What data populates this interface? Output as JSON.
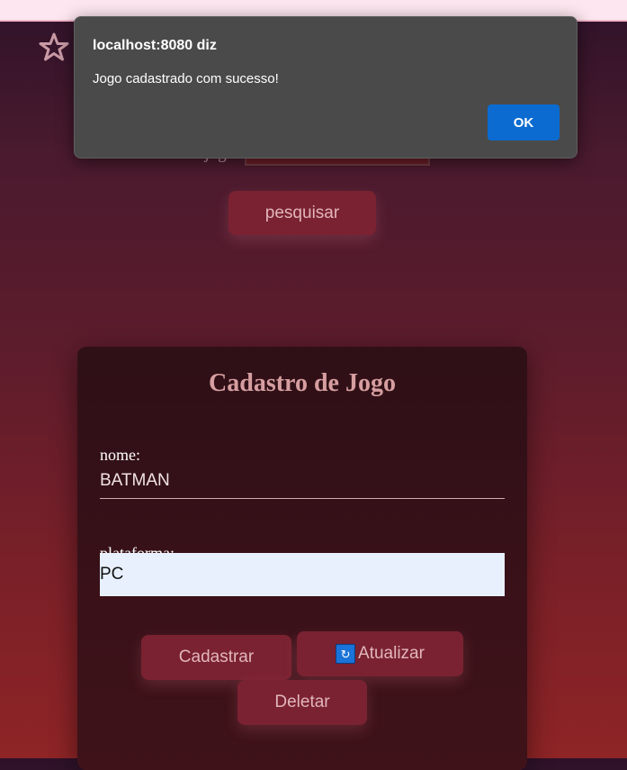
{
  "page": {
    "id_label": "Id do jogo:",
    "search_button": "pesquisar"
  },
  "form": {
    "title": "Cadastro de Jogo",
    "nome_label": "nome:",
    "nome_value": "BATMAN",
    "plataforma_label": "plataforma:",
    "plataforma_value": "PC",
    "buttons": {
      "cadastrar": "Cadastrar",
      "atualizar": "Atualizar",
      "deletar": "Deletar"
    }
  },
  "dialog": {
    "title": "localhost:8080 diz",
    "message": "Jogo cadastrado com sucesso!",
    "ok_label": "OK"
  },
  "icons": {
    "star": "star-outline-icon",
    "sync": "sync-icon"
  },
  "colors": {
    "accent_button": "#7a2231",
    "dialog_ok": "#0b6bd0",
    "dialog_bg": "#4a4a4a"
  }
}
